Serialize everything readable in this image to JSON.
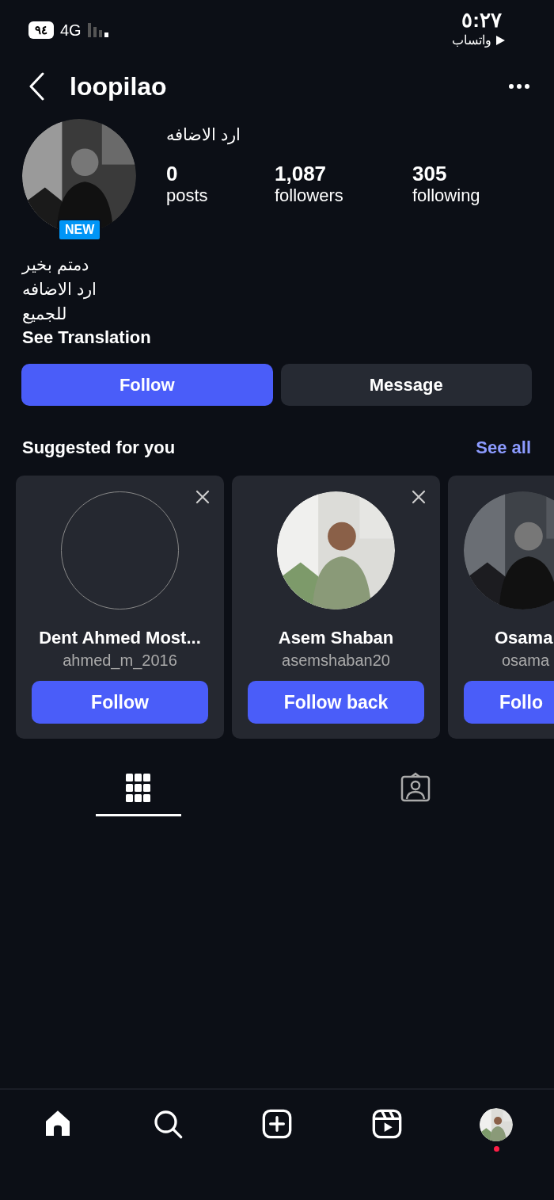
{
  "status_bar": {
    "battery": "٩٤",
    "network": "4G",
    "time": "٥:٢٧",
    "back_app": "واتساب"
  },
  "header": {
    "username": "loopilao"
  },
  "profile": {
    "name": "ارد الاضافه",
    "badge": "NEW",
    "stats": [
      {
        "value": "0",
        "label": "posts"
      },
      {
        "value": "1,087",
        "label": "followers"
      },
      {
        "value": "305",
        "label": "following"
      }
    ],
    "bio": [
      "دمتم بخير",
      "ارد الاضافه",
      "للجميع"
    ],
    "translation_link": "See Translation"
  },
  "actions": [
    {
      "label": "Follow",
      "kind": "primary"
    },
    {
      "label": "Message",
      "kind": "secondary"
    }
  ],
  "suggested": {
    "title": "Suggested for you",
    "see_all": "See all",
    "cards": [
      {
        "name": "Dent Ahmed Most...",
        "handle": "ahmed_m_2016",
        "button": "Follow",
        "kind": "placeholder",
        "dismissible": true
      },
      {
        "name": "Asem Shaban",
        "handle": "asemshaban20",
        "button": "Follow back",
        "dismissible": true
      },
      {
        "name": "Osama",
        "handle": "osama",
        "button": "Follo",
        "dismissible": false
      }
    ]
  },
  "content_tabs": [
    {
      "kind": "grid",
      "selected": true
    },
    {
      "kind": "tagged",
      "selected": false
    }
  ],
  "bottom_nav": [
    {
      "kind": "home"
    },
    {
      "kind": "search"
    },
    {
      "kind": "create"
    },
    {
      "kind": "reels"
    },
    {
      "kind": "profile",
      "notification": true
    }
  ]
}
